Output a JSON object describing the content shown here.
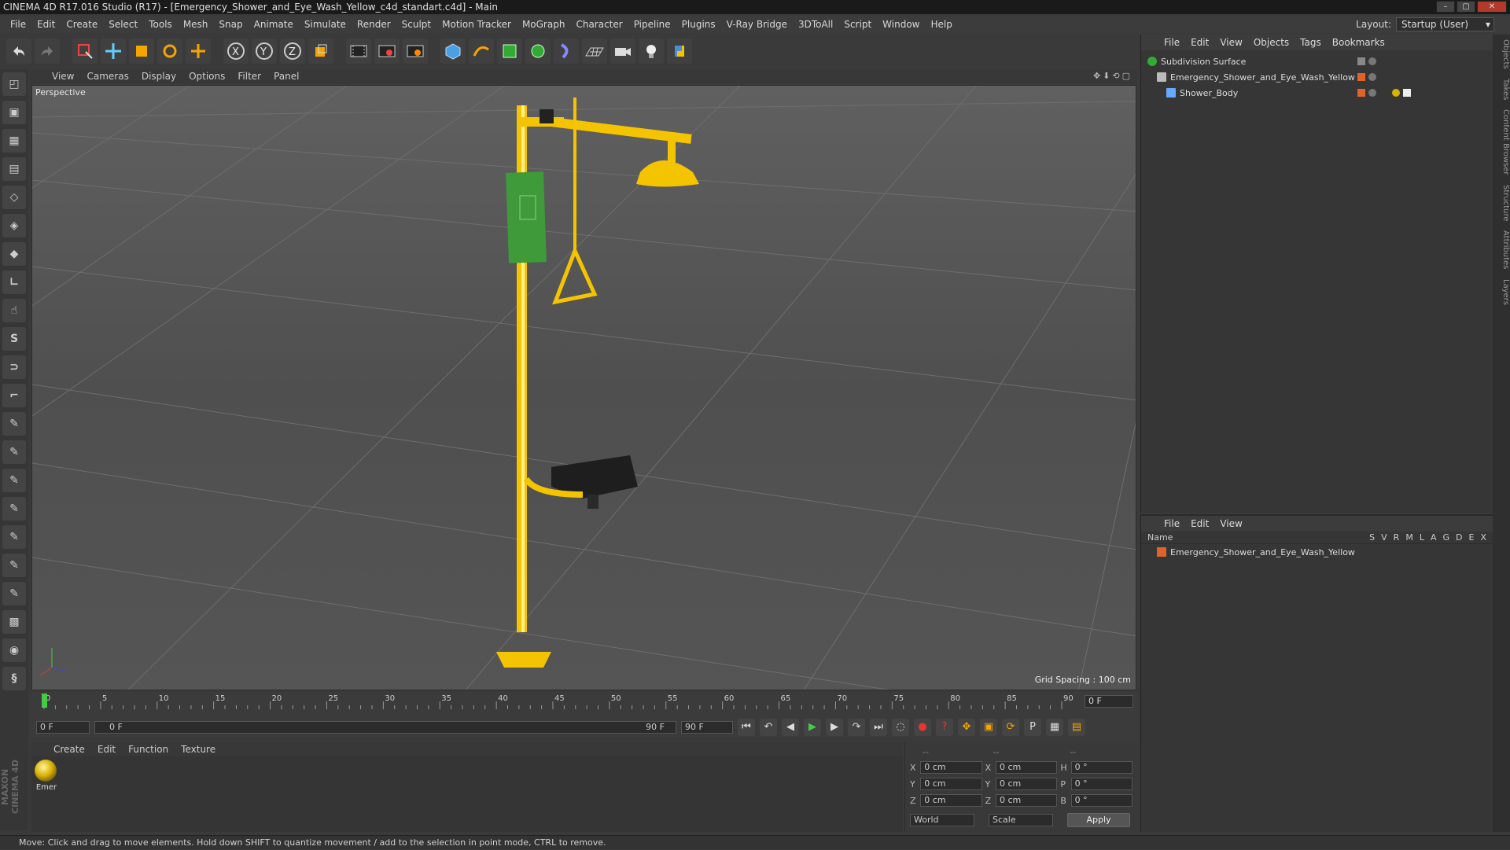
{
  "window": {
    "title": "CINEMA 4D R17.016 Studio (R17) - [Emergency_Shower_and_Eye_Wash_Yellow_c4d_standart.c4d] - Main"
  },
  "menubar": {
    "items": [
      "File",
      "Edit",
      "Create",
      "Select",
      "Tools",
      "Mesh",
      "Snap",
      "Animate",
      "Simulate",
      "Render",
      "Sculpt",
      "Motion Tracker",
      "MoGraph",
      "Character",
      "Pipeline",
      "Plugins",
      "V-Ray Bridge",
      "3DToAll",
      "Script",
      "Window",
      "Help"
    ],
    "layout_label": "Layout:",
    "layout_value": "Startup (User)"
  },
  "viewport": {
    "menu": [
      "View",
      "Cameras",
      "Display",
      "Options",
      "Filter",
      "Panel"
    ],
    "label": "Perspective",
    "grid_spacing": "Grid Spacing : 100 cm"
  },
  "timeline": {
    "ticks": [
      "0",
      "5",
      "10",
      "15",
      "20",
      "25",
      "30",
      "35",
      "40",
      "45",
      "50",
      "55",
      "60",
      "65",
      "70",
      "75",
      "80",
      "85",
      "90"
    ],
    "current_frame": "0 F",
    "start_field": "0 F",
    "range_start": "0 F",
    "range_end": "90 F",
    "end_field": "90 F"
  },
  "material_manager": {
    "menu": [
      "Create",
      "Edit",
      "Function",
      "Texture"
    ],
    "materials": [
      {
        "name": "Emer"
      }
    ]
  },
  "coordinates": {
    "headers": [
      "--",
      "--",
      "--"
    ],
    "rows": [
      {
        "a": "X",
        "av": "0 cm",
        "b": "X",
        "bv": "0 cm",
        "c": "H",
        "cv": "0 °"
      },
      {
        "a": "Y",
        "av": "0 cm",
        "b": "Y",
        "bv": "0 cm",
        "c": "P",
        "cv": "0 °"
      },
      {
        "a": "Z",
        "av": "0 cm",
        "b": "Z",
        "bv": "0 cm",
        "c": "B",
        "cv": "0 °"
      }
    ],
    "world": "World",
    "scale": "Scale",
    "apply": "Apply"
  },
  "object_manager": {
    "menu": [
      "File",
      "Edit",
      "View",
      "Objects",
      "Tags",
      "Bookmarks"
    ],
    "objects": [
      {
        "name": "Subdivision Surface",
        "indent": 0
      },
      {
        "name": "Emergency_Shower_and_Eye_Wash_Yellow",
        "indent": 1
      },
      {
        "name": "Shower_Body",
        "indent": 2
      }
    ]
  },
  "layer_manager": {
    "menu": [
      "File",
      "Edit",
      "View"
    ],
    "name_header": "Name",
    "columns": [
      "S",
      "V",
      "R",
      "M",
      "L",
      "A",
      "G",
      "D",
      "E",
      "X"
    ],
    "layers": [
      {
        "name": "Emergency_Shower_and_Eye_Wash_Yellow"
      }
    ]
  },
  "side_tabs": [
    "Objects",
    "Takes",
    "Content Browser",
    "Structure",
    "Attributes",
    "Layers"
  ],
  "brand": "MAXON CINEMA 4D",
  "status": "Move: Click and drag to move elements. Hold down SHIFT to quantize movement / add to the selection in point mode, CTRL to remove.",
  "colors": {
    "accent_yellow": "#f5c400",
    "sign_green": "#3f9a3a",
    "layer_orange": "#e0642a"
  }
}
